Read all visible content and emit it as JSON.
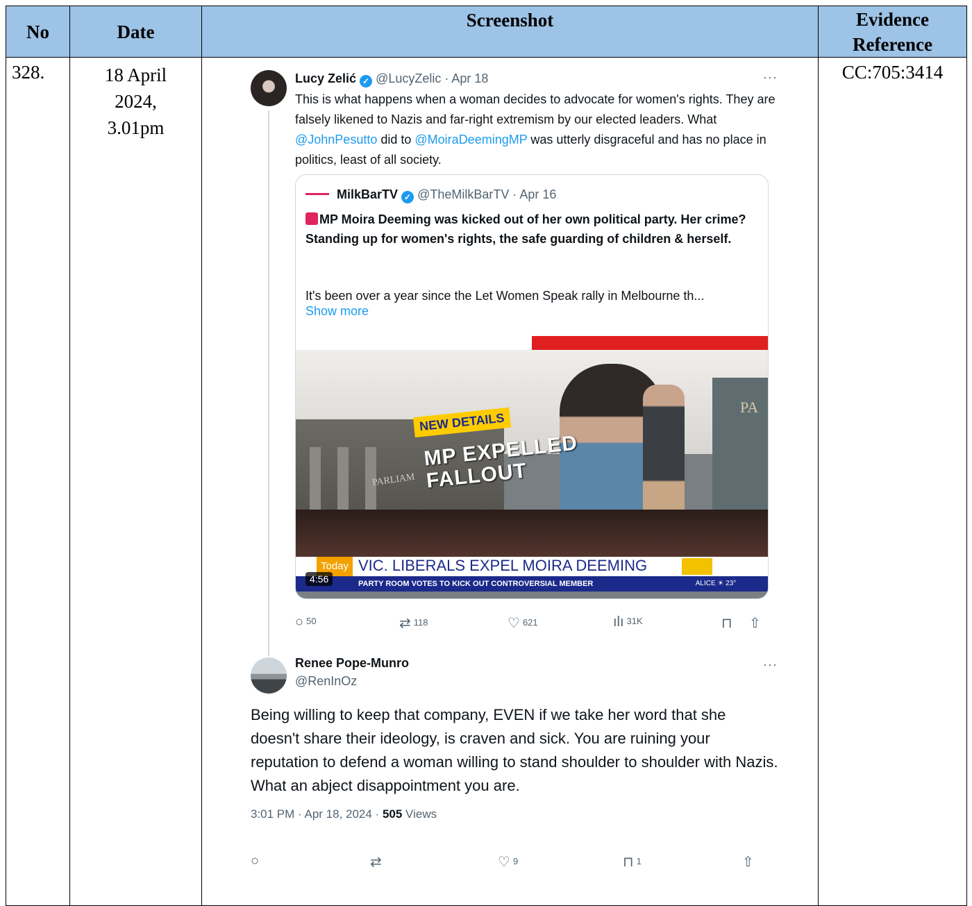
{
  "headers": {
    "no": "No",
    "date": "Date",
    "screenshot": "Screenshot",
    "evidence": "Evidence Reference"
  },
  "row": {
    "no": "328.",
    "date_line1": "18 April",
    "date_line2": "2024,",
    "date_line3": "3.01pm",
    "reference": "CC:705:3414"
  },
  "tweet": {
    "author_name": "Lucy Zelić",
    "author_handle": "@LucyZelic",
    "date": "Apr 18",
    "more": "···",
    "text_1": "This is what happens when a woman decides to advocate for women's rights. They are falsely likened to Nazis and far-right extremism by our elected leaders. What ",
    "mention_1": "@JohnPesutto",
    "text_2": " did to ",
    "mention_2": "@MoiraDeemingMP",
    "text_3": " was utterly disgraceful and has no place in politics, least of all society."
  },
  "quote": {
    "author_name": "MilkBarTV",
    "author_handle": "@TheMilkBarTV",
    "date": "Apr 16",
    "bold_text": "MP Moira Deeming was kicked out of her own political party. Her crime? Standing up for women's rights, the safe guarding of children & herself.",
    "body": "It's been over a year since the Let Women Speak rally in Melbourne th...",
    "show_more": "Show more",
    "media": {
      "badge": "NEW DETAILS",
      "title_line1": "MP EXPELLED",
      "title_line2": "FALLOUT",
      "building_text": "PARLIAM",
      "wall_text": "PA",
      "today": "Today",
      "headline": "VIC. LIBERALS EXPEL MOIRA DEEMING",
      "subline": "PARTY ROOM VOTES TO KICK OUT CONTROVERSIAL MEMBER",
      "weather": "ALICE ☀ 23°",
      "duration": "4:56"
    }
  },
  "tweet_actions": {
    "replies": "50",
    "reposts": "118",
    "likes": "621",
    "views": "31K"
  },
  "reply": {
    "author_name": "Renee Pope-Munro",
    "author_handle": "@RenInOz",
    "more": "···",
    "text": "Being willing to keep that company, EVEN if we take her word that she doesn't share their ideology, is craven and sick. You are ruining your reputation to defend a woman willing to stand shoulder to shoulder with Nazis. What an abject disappointment you are.",
    "meta_time": "3:01 PM · Apr 18, 2024 · ",
    "meta_views_count": "505",
    "meta_views_label": " Views"
  },
  "reply_actions": {
    "likes": "9",
    "bookmarks": "1"
  },
  "icons": {
    "reply": "reply-icon",
    "repost": "repost-icon",
    "like": "heart-icon",
    "views": "views-icon",
    "bookmark": "bookmark-icon",
    "share": "share-icon",
    "verified": "verified-badge-icon"
  },
  "colors": {
    "header_bg": "#9dc3e6",
    "link": "#1d9bf0",
    "muted": "#536471"
  }
}
